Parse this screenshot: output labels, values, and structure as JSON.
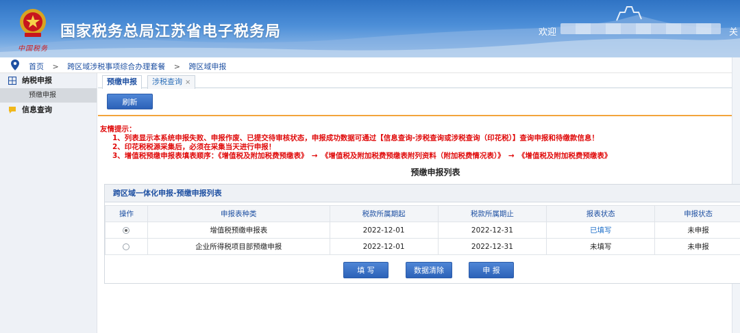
{
  "header": {
    "title": "国家税务总局江苏省电子税务局",
    "emblem_text": "中国税务",
    "welcome": "欢迎",
    "close": "关"
  },
  "breadcrumb": {
    "items": [
      "首页",
      "跨区域涉税事项综合办理套餐",
      "跨区域申报"
    ],
    "separator": ">"
  },
  "sidebar": {
    "groups": [
      {
        "label": "纳税申报",
        "items": [
          "预缴申报"
        ]
      },
      {
        "label": "信息查询",
        "items": []
      }
    ]
  },
  "tabs": [
    {
      "label": "预缴申报",
      "active": true
    },
    {
      "label": "涉税查询",
      "close": "×"
    }
  ],
  "toolbar": {
    "refresh": "刷新"
  },
  "notice": {
    "title": "友情提示：",
    "lines": [
      "1、列表显示本系统申报失败、申报作废、已提交待审核状态，申报成功数据可通过【信息查询-涉税查询或涉税查询（印花税）】查询申报和待缴款信息！",
      "2、印花税税源采集后，必须在采集当天进行申报！",
      "3、增值税预缴申报表填表顺序：《增值税及附加税费预缴表》　→　《增值税及附加税费预缴表附列资料（附加税费情况表）》　→　《增值税及附加税费预缴表》"
    ]
  },
  "list_title": "预缴申报列表",
  "panel": {
    "title": "跨区域一体化申报-预缴申报列表",
    "columns": [
      "操作",
      "申报表种类",
      "税款所属期起",
      "税款所属期止",
      "报表状态",
      "申报状态"
    ],
    "rows": [
      {
        "selected": true,
        "type": "增值税预缴申报表",
        "start": "2022-12-01",
        "end": "2022-12-31",
        "report_status": "已填写",
        "declare_status": "未申报"
      },
      {
        "selected": false,
        "type": "企业所得税项目部预缴申报",
        "start": "2022-12-01",
        "end": "2022-12-31",
        "report_status": "未填写",
        "declare_status": "未申报"
      }
    ]
  },
  "actions": {
    "fill": "填 写",
    "clear": "数据清除",
    "declare": "申 报"
  },
  "colors": {
    "accent": "#2c62b8",
    "warning": "#e00b0b",
    "divider": "#f3a43b"
  }
}
